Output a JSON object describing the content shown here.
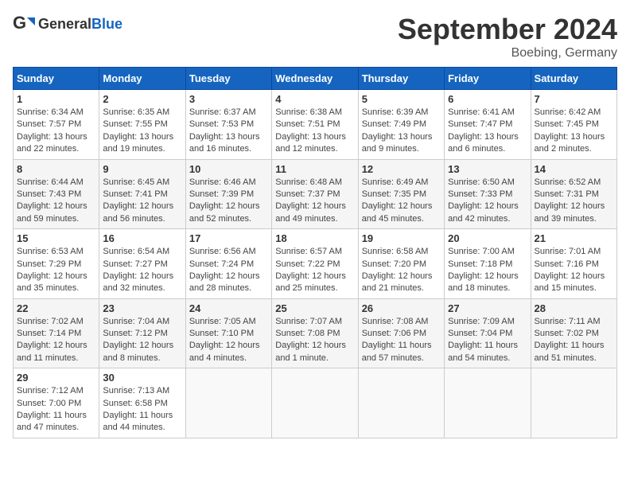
{
  "header": {
    "logo_general": "General",
    "logo_blue": "Blue",
    "title": "September 2024",
    "location": "Boebing, Germany"
  },
  "columns": [
    "Sunday",
    "Monday",
    "Tuesday",
    "Wednesday",
    "Thursday",
    "Friday",
    "Saturday"
  ],
  "weeks": [
    [
      {
        "day": "1",
        "sunrise": "Sunrise: 6:34 AM",
        "sunset": "Sunset: 7:57 PM",
        "daylight": "Daylight: 13 hours and 22 minutes."
      },
      {
        "day": "2",
        "sunrise": "Sunrise: 6:35 AM",
        "sunset": "Sunset: 7:55 PM",
        "daylight": "Daylight: 13 hours and 19 minutes."
      },
      {
        "day": "3",
        "sunrise": "Sunrise: 6:37 AM",
        "sunset": "Sunset: 7:53 PM",
        "daylight": "Daylight: 13 hours and 16 minutes."
      },
      {
        "day": "4",
        "sunrise": "Sunrise: 6:38 AM",
        "sunset": "Sunset: 7:51 PM",
        "daylight": "Daylight: 13 hours and 12 minutes."
      },
      {
        "day": "5",
        "sunrise": "Sunrise: 6:39 AM",
        "sunset": "Sunset: 7:49 PM",
        "daylight": "Daylight: 13 hours and 9 minutes."
      },
      {
        "day": "6",
        "sunrise": "Sunrise: 6:41 AM",
        "sunset": "Sunset: 7:47 PM",
        "daylight": "Daylight: 13 hours and 6 minutes."
      },
      {
        "day": "7",
        "sunrise": "Sunrise: 6:42 AM",
        "sunset": "Sunset: 7:45 PM",
        "daylight": "Daylight: 13 hours and 2 minutes."
      }
    ],
    [
      {
        "day": "8",
        "sunrise": "Sunrise: 6:44 AM",
        "sunset": "Sunset: 7:43 PM",
        "daylight": "Daylight: 12 hours and 59 minutes."
      },
      {
        "day": "9",
        "sunrise": "Sunrise: 6:45 AM",
        "sunset": "Sunset: 7:41 PM",
        "daylight": "Daylight: 12 hours and 56 minutes."
      },
      {
        "day": "10",
        "sunrise": "Sunrise: 6:46 AM",
        "sunset": "Sunset: 7:39 PM",
        "daylight": "Daylight: 12 hours and 52 minutes."
      },
      {
        "day": "11",
        "sunrise": "Sunrise: 6:48 AM",
        "sunset": "Sunset: 7:37 PM",
        "daylight": "Daylight: 12 hours and 49 minutes."
      },
      {
        "day": "12",
        "sunrise": "Sunrise: 6:49 AM",
        "sunset": "Sunset: 7:35 PM",
        "daylight": "Daylight: 12 hours and 45 minutes."
      },
      {
        "day": "13",
        "sunrise": "Sunrise: 6:50 AM",
        "sunset": "Sunset: 7:33 PM",
        "daylight": "Daylight: 12 hours and 42 minutes."
      },
      {
        "day": "14",
        "sunrise": "Sunrise: 6:52 AM",
        "sunset": "Sunset: 7:31 PM",
        "daylight": "Daylight: 12 hours and 39 minutes."
      }
    ],
    [
      {
        "day": "15",
        "sunrise": "Sunrise: 6:53 AM",
        "sunset": "Sunset: 7:29 PM",
        "daylight": "Daylight: 12 hours and 35 minutes."
      },
      {
        "day": "16",
        "sunrise": "Sunrise: 6:54 AM",
        "sunset": "Sunset: 7:27 PM",
        "daylight": "Daylight: 12 hours and 32 minutes."
      },
      {
        "day": "17",
        "sunrise": "Sunrise: 6:56 AM",
        "sunset": "Sunset: 7:24 PM",
        "daylight": "Daylight: 12 hours and 28 minutes."
      },
      {
        "day": "18",
        "sunrise": "Sunrise: 6:57 AM",
        "sunset": "Sunset: 7:22 PM",
        "daylight": "Daylight: 12 hours and 25 minutes."
      },
      {
        "day": "19",
        "sunrise": "Sunrise: 6:58 AM",
        "sunset": "Sunset: 7:20 PM",
        "daylight": "Daylight: 12 hours and 21 minutes."
      },
      {
        "day": "20",
        "sunrise": "Sunrise: 7:00 AM",
        "sunset": "Sunset: 7:18 PM",
        "daylight": "Daylight: 12 hours and 18 minutes."
      },
      {
        "day": "21",
        "sunrise": "Sunrise: 7:01 AM",
        "sunset": "Sunset: 7:16 PM",
        "daylight": "Daylight: 12 hours and 15 minutes."
      }
    ],
    [
      {
        "day": "22",
        "sunrise": "Sunrise: 7:02 AM",
        "sunset": "Sunset: 7:14 PM",
        "daylight": "Daylight: 12 hours and 11 minutes."
      },
      {
        "day": "23",
        "sunrise": "Sunrise: 7:04 AM",
        "sunset": "Sunset: 7:12 PM",
        "daylight": "Daylight: 12 hours and 8 minutes."
      },
      {
        "day": "24",
        "sunrise": "Sunrise: 7:05 AM",
        "sunset": "Sunset: 7:10 PM",
        "daylight": "Daylight: 12 hours and 4 minutes."
      },
      {
        "day": "25",
        "sunrise": "Sunrise: 7:07 AM",
        "sunset": "Sunset: 7:08 PM",
        "daylight": "Daylight: 12 hours and 1 minute."
      },
      {
        "day": "26",
        "sunrise": "Sunrise: 7:08 AM",
        "sunset": "Sunset: 7:06 PM",
        "daylight": "Daylight: 11 hours and 57 minutes."
      },
      {
        "day": "27",
        "sunrise": "Sunrise: 7:09 AM",
        "sunset": "Sunset: 7:04 PM",
        "daylight": "Daylight: 11 hours and 54 minutes."
      },
      {
        "day": "28",
        "sunrise": "Sunrise: 7:11 AM",
        "sunset": "Sunset: 7:02 PM",
        "daylight": "Daylight: 11 hours and 51 minutes."
      }
    ],
    [
      {
        "day": "29",
        "sunrise": "Sunrise: 7:12 AM",
        "sunset": "Sunset: 7:00 PM",
        "daylight": "Daylight: 11 hours and 47 minutes."
      },
      {
        "day": "30",
        "sunrise": "Sunrise: 7:13 AM",
        "sunset": "Sunset: 6:58 PM",
        "daylight": "Daylight: 11 hours and 44 minutes."
      },
      null,
      null,
      null,
      null,
      null
    ]
  ]
}
